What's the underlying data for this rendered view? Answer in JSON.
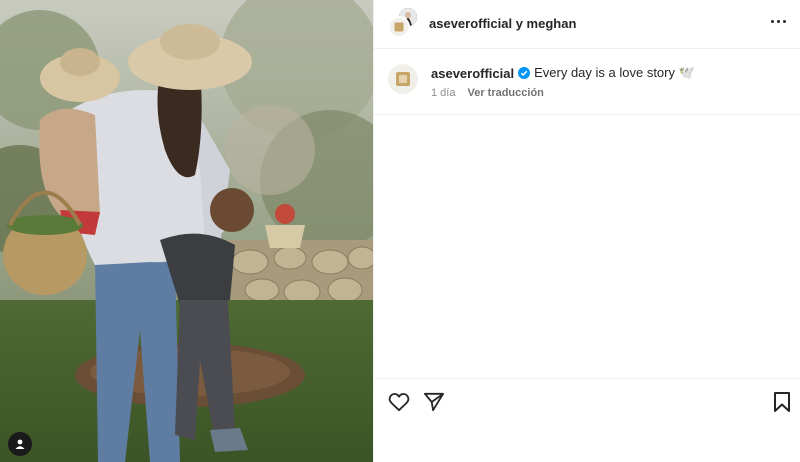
{
  "post": {
    "header_usernames": "aseverofficial y meghan",
    "caption_username": "aseverofficial",
    "caption_text": "Every day is a love story 🕊️",
    "timestamp": "1 día",
    "translate_label": "Ver traducción"
  },
  "icons": {
    "more": "more-options-icon",
    "like": "heart-icon",
    "share": "send-icon",
    "save": "bookmark-icon",
    "verified": "verified-badge-icon",
    "tags": "user-tag-icon"
  },
  "colors": {
    "verified": "#0095f6",
    "text": "#262626",
    "secondary": "#8e8e8e"
  }
}
